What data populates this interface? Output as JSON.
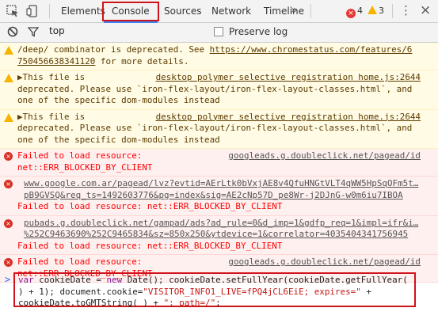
{
  "tabs": [
    "Elements",
    "Console",
    "Sources",
    "Network",
    "Timeline"
  ],
  "more_label": "»",
  "errors_count": "4",
  "warnings_count": "3",
  "icons": {
    "inspect": "select-element-icon",
    "device": "device-toolbar-icon",
    "clear": "clear-console-icon",
    "filter": "filter-icon",
    "menu": "kebab-menu-icon",
    "close": "close-icon",
    "warning": "warning-icon",
    "error": "error-icon"
  },
  "colors": {
    "highlight": "#d0121a",
    "error_text": "#ff0000",
    "warning_bg": "#fffbe5",
    "error_bg": "#fff0f0"
  },
  "filter": {
    "context": "top",
    "preserve_log_label": "Preserve log"
  },
  "messages": [
    {
      "level": "warning",
      "line1": "/deep/ combinator is deprecated. See ",
      "link1": "https://www.chromestatus.com/features/6",
      "link2": "750456638341120",
      "line2_rest": " for more details."
    },
    {
      "level": "warning",
      "line1": "▶This file is",
      "source": "desktop polymer selective registration home.js:2644",
      "line2": "deprecated. Please use `iron-flex-layout/iron-flex-layout-classes.html`, and",
      "line3": "one of the specific dom-modules instead"
    },
    {
      "level": "warning",
      "line1": "▶This file is",
      "source": "desktop polymer selective registration home.js:2644",
      "line2": "deprecated. Please use `iron-flex-layout/iron-flex-layout-classes.html`, and",
      "line3": "one of the specific dom-modules instead"
    },
    {
      "level": "error",
      "line1": "Failed to load resource:",
      "source": "googleads.g.doubleclick.net/pagead/id",
      "line2": "net::ERR_BLOCKED_BY_CLIENT"
    },
    {
      "level": "error",
      "url1": "www.google.com.ar/pagead/lvz?evtid=AErLtk0bVxjAE8v4QfuHNGtVLT4qWW5HpSqOFm5t…",
      "url2": "pB9GVSQ&req_ts=1492603776&pg=index&sig=AE2cNp57D_pe8Wr-j2DJnG-w0m6iu7IBOA",
      "line2": "Failed to load resource: net::ERR_BLOCKED_BY_CLIENT"
    },
    {
      "level": "error",
      "url1": "pubads.g.doubleclick.net/gampad/ads?ad_rule=0&d_imp=1&gdfp_req=1&impl=ifr&i…",
      "url2": "%252C9463690%252C9465834&sz=850x250&ytdevice=1&correlator=4035404341756945",
      "line2": "Failed to load resource: net::ERR_BLOCKED_BY_CLIENT"
    },
    {
      "level": "error",
      "line1": "Failed to load resource:",
      "source": "googleads.g.doubleclick.net/pagead/id",
      "line2": "net::ERR_BLOCKED_BY_CLIENT"
    }
  ],
  "prompt": {
    "chevron": ">",
    "kw_var": "var",
    "seg1": " cookieDate = ",
    "kw_new": "new",
    "seg2": " Date(); cookieDate.setFullYear(cookieDate.getFullYear(",
    "seg3": ") + 1); document.cookie=",
    "str1": "\"VISITOR_INFO1_LIVE=fPQ4jCL6EiE; expires=\"",
    "seg4": " +",
    "seg5": "cookieDate.toGMTString( ) + ",
    "str2": "\"; path=/\"",
    "seg6": ";"
  }
}
